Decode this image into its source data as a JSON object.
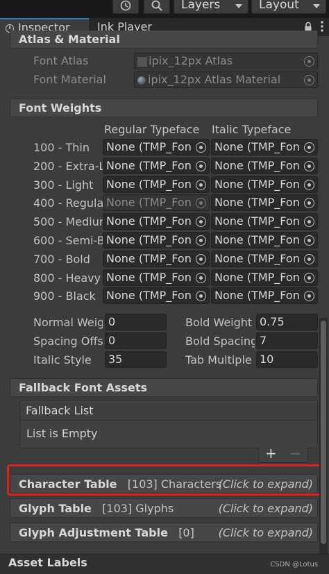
{
  "toolbar": {
    "history_icon": "history-icon",
    "search_icon": "search-icon",
    "layers_label": "Layers",
    "layout_label": "Layout"
  },
  "tabs": {
    "inspector": "Inspector",
    "ink_player": "Ink Player",
    "lock_icon": "lock-icon",
    "menu_icon": "kebab-menu-icon"
  },
  "atlas_material": {
    "header": "Atlas & Material",
    "font_atlas_label": "Font Atlas",
    "font_atlas_value": "ipix_12px Atlas",
    "font_material_label": "Font Material",
    "font_material_value": "ipix_12px Atlas Material"
  },
  "font_weights": {
    "header": "Font Weights",
    "col_regular": "Regular Typeface",
    "col_italic": "Italic Typeface",
    "rows": [
      {
        "label": "100 - Thin",
        "regular": "None (TMP_Fon",
        "italic": "None (TMP_Fon",
        "disabled": false
      },
      {
        "label": "200 - Extra-L",
        "regular": "None (TMP_Fon",
        "italic": "None (TMP_Fon",
        "disabled": false
      },
      {
        "label": "300 - Light",
        "regular": "None (TMP_Fon",
        "italic": "None (TMP_Fon",
        "disabled": false
      },
      {
        "label": "400 - Regula",
        "regular": "None (TMP_Fon",
        "italic": "None (TMP_Fon",
        "disabled": true
      },
      {
        "label": "500 - Mediur",
        "regular": "None (TMP_Fon",
        "italic": "None (TMP_Fon",
        "disabled": false
      },
      {
        "label": "600 - Semi-B",
        "regular": "None (TMP_Fon",
        "italic": "None (TMP_Fon",
        "disabled": false
      },
      {
        "label": "700 - Bold",
        "regular": "None (TMP_Fon",
        "italic": "None (TMP_Fon",
        "disabled": false
      },
      {
        "label": "800 - Heavy",
        "regular": "None (TMP_Fon",
        "italic": "None (TMP_Fon",
        "disabled": false
      },
      {
        "label": "900 - Black",
        "regular": "None (TMP_Fon",
        "italic": "None (TMP_Fon",
        "disabled": false
      }
    ]
  },
  "style_settings": {
    "normal_weight_label": "Normal Weigl",
    "normal_weight_value": "0",
    "bold_weight_label": "Bold Weight",
    "bold_weight_value": "0.75",
    "spacing_offset_label": "Spacing Offs",
    "spacing_offset_value": "0",
    "bold_spacing_label": "Bold Spacing",
    "bold_spacing_value": "7",
    "italic_style_label": "Italic Style",
    "italic_style_value": "35",
    "tab_multiple_label": "Tab Multiple",
    "tab_multiple_value": "10"
  },
  "fallback": {
    "header": "Fallback Font Assets",
    "list_title": "Fallback List",
    "empty_text": "List is Empty",
    "add_label": "+",
    "remove_label": "−"
  },
  "tables": {
    "character_title": "Character Table",
    "character_count": "[103] Characters",
    "glyph_title": "Glyph Table",
    "glyph_count": "[103] Glyphs",
    "glyph_adjust_title": "Glyph Adjustment Table",
    "glyph_adjust_count": "[0]",
    "expand_hint": "(Click to expand)"
  },
  "asset_labels": "Asset Labels",
  "watermark": "CSDN @Lotus",
  "colors": {
    "highlight": "#e0201e",
    "tab_accent": "#3a79bb"
  }
}
